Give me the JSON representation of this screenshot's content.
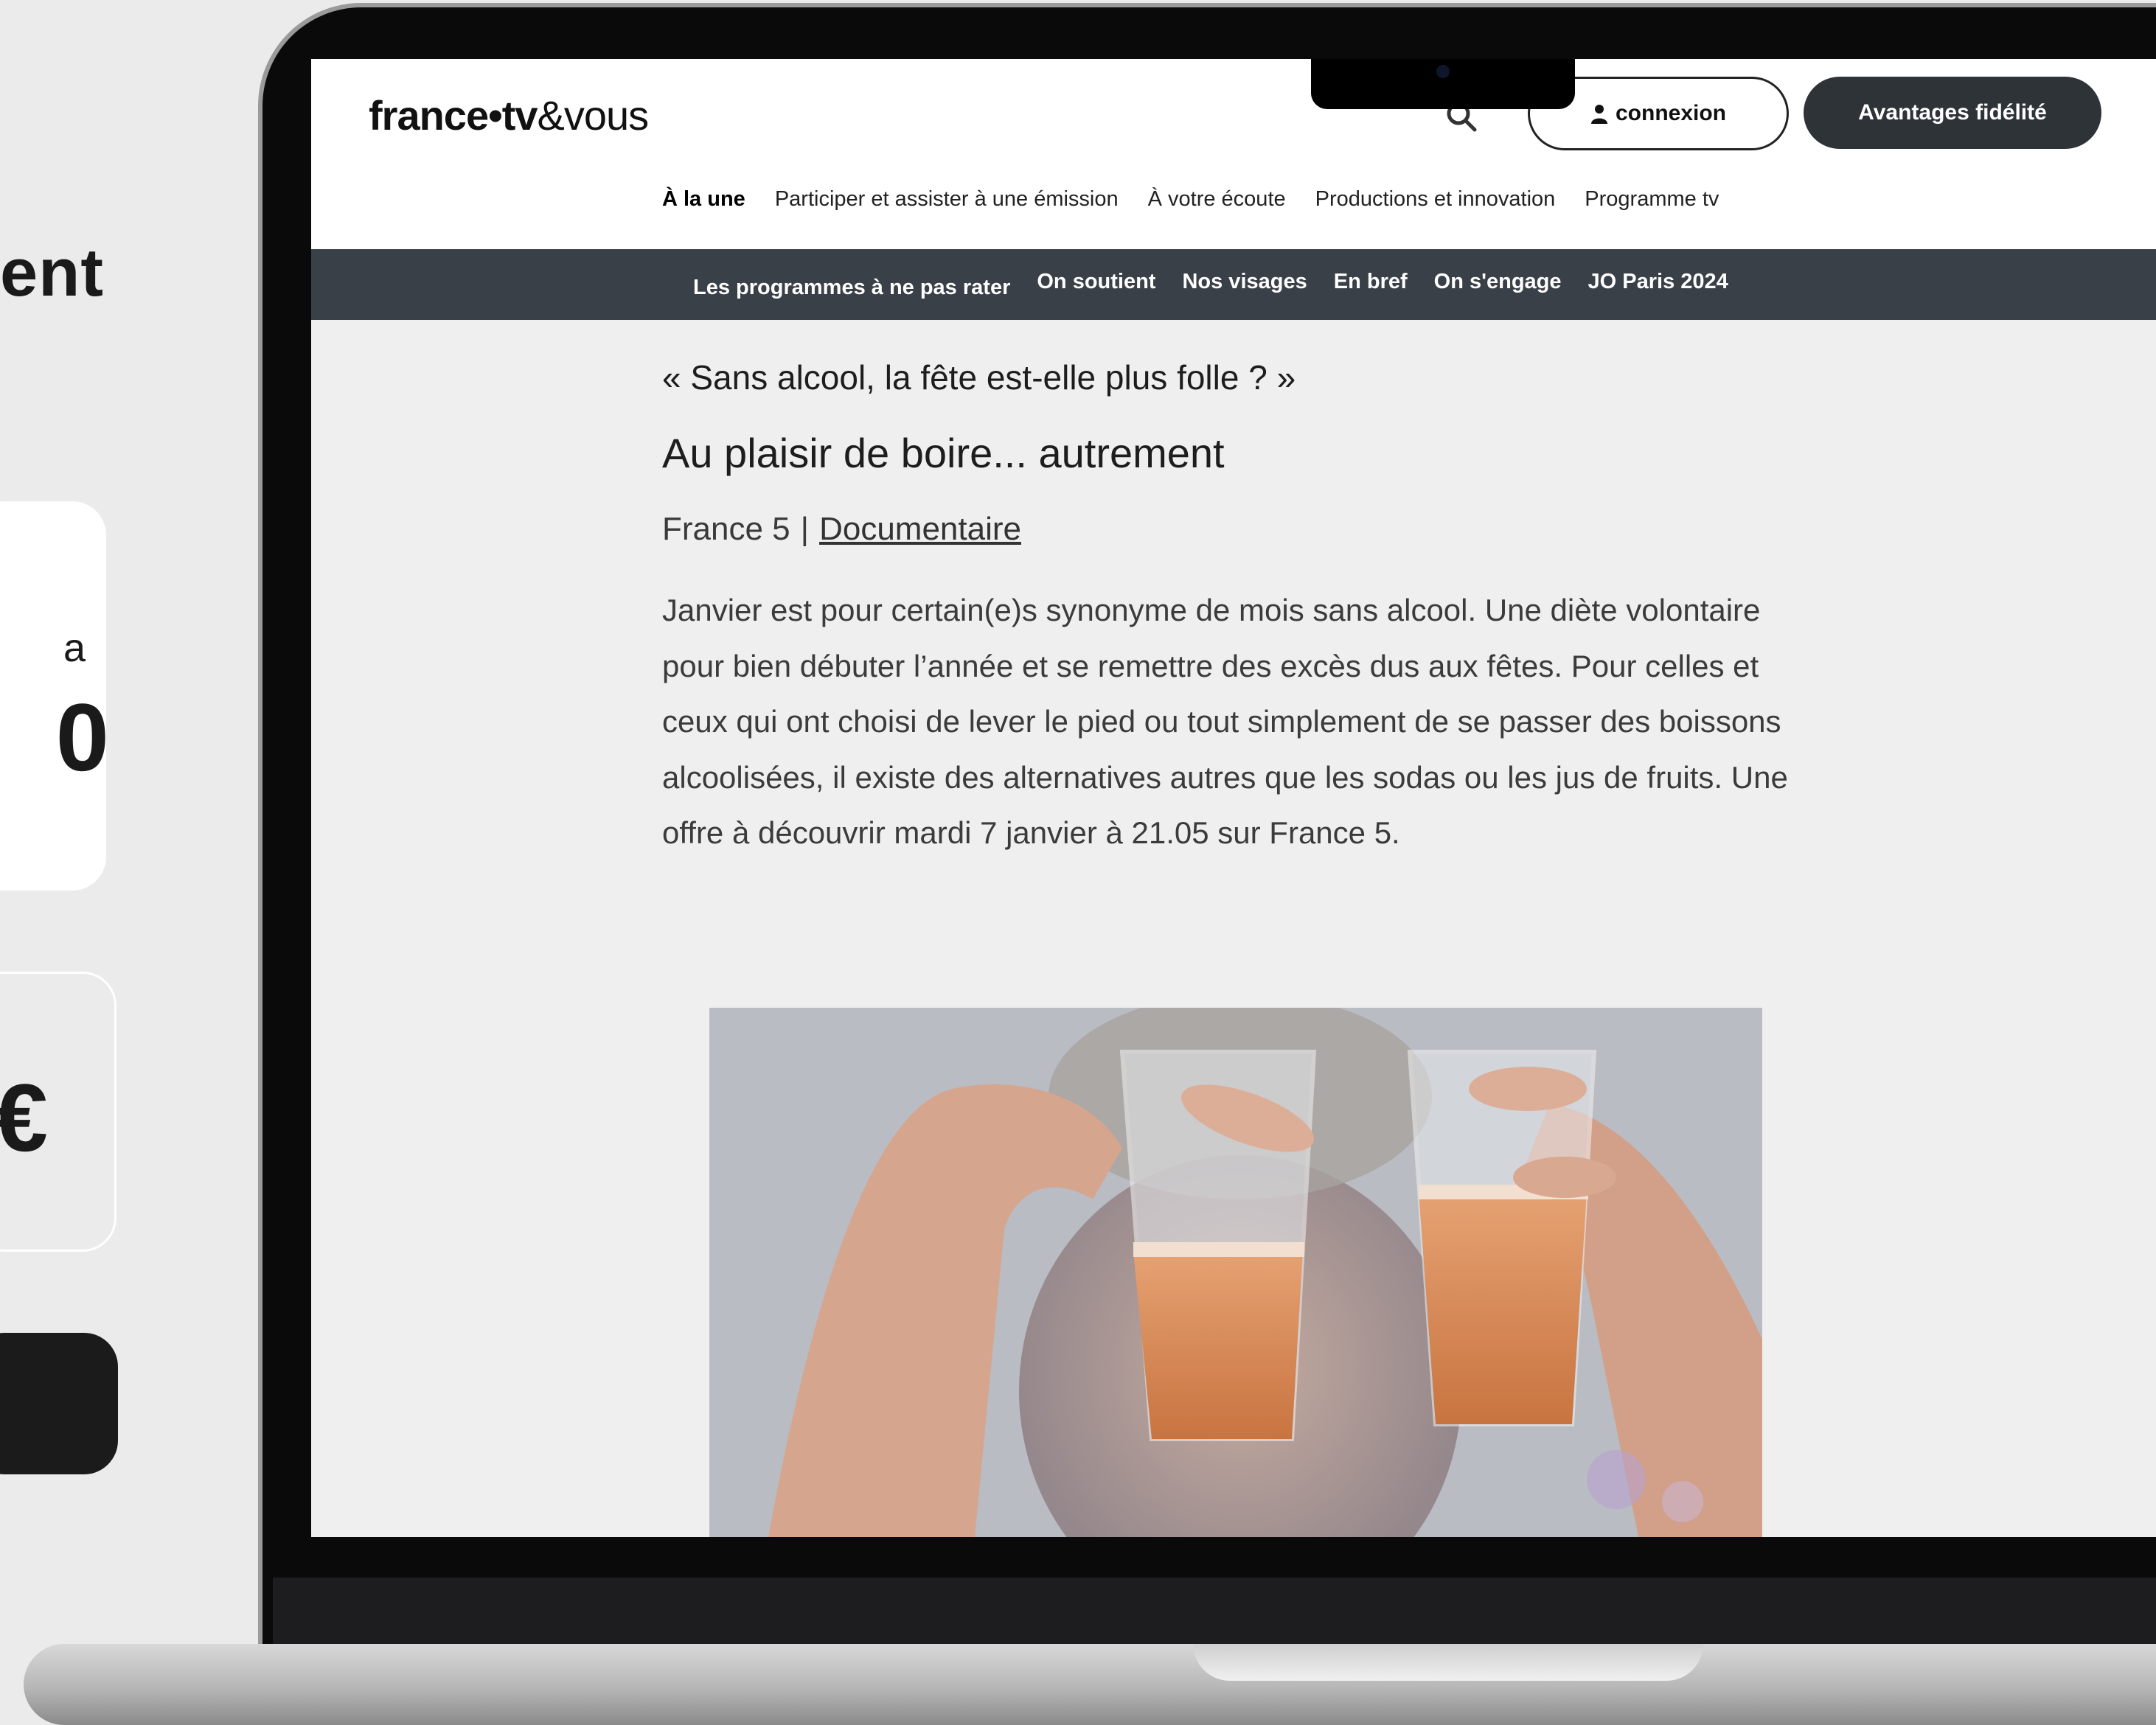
{
  "left_panel": {
    "heading_fragment": "ent",
    "card1_small": "a",
    "card1_big": "0",
    "card2_symbol": "€"
  },
  "site": {
    "logo_main": "france•tv",
    "logo_suffix": "&vous",
    "connexion_label": "connexion",
    "avantages_label": "Avantages fidélité",
    "main_nav": [
      "À la une",
      "Participer et assister à une émission",
      "À votre écoute",
      "Productions et innovation",
      "Programme tv"
    ],
    "sub_nav": [
      "Les programmes à ne pas rater",
      "On soutient",
      "Nos visages",
      "En bref",
      "On s'engage",
      "JO Paris 2024"
    ]
  },
  "article": {
    "kicker": "« Sans alcool, la fête est-elle plus folle ? »",
    "title": "Au plaisir de boire... autrement",
    "channel": "France 5",
    "separator": "|",
    "genre": "Documentaire",
    "body": "Janvier est pour certain(e)s synonyme de mois sans alcool. Une diète volontaire pour bien débuter l’année et se remettre des excès dus aux fêtes. Pour celles et ceux qui ont choisi de lever le pied ou tout simplement de se passer des boissons alcoolisées, il existe des alternatives autres que les sodas ou les jus de fruits. Une offre à découvrir mardi 7 janvier à 21.05 sur France 5."
  },
  "colors": {
    "header_bg": "#ffffff",
    "subnav_bg": "#3a4048",
    "avantages_bg": "#2e3338",
    "page_bg": "#efefef",
    "drink": "#d9844a"
  },
  "icons": {
    "search": "search-icon",
    "user": "user-icon"
  }
}
